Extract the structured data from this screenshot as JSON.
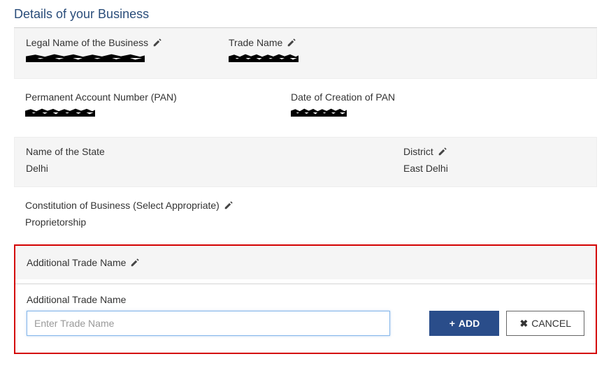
{
  "section_title": "Details of your Business",
  "fields": {
    "legal_name": {
      "label": "Legal Name of the Business",
      "value": "[REDACTED]"
    },
    "trade_name": {
      "label": "Trade Name",
      "value": "[REDACTED]"
    },
    "pan": {
      "label": "Permanent Account Number (PAN)",
      "value": "[REDACTED]"
    },
    "pan_date": {
      "label": "Date of Creation of PAN",
      "value": "[REDACTED]"
    },
    "state": {
      "label": "Name of the State",
      "value": "Delhi"
    },
    "district": {
      "label": "District",
      "value": "East Delhi"
    },
    "constitution": {
      "label": "Constitution of Business (Select Appropriate)",
      "value": "Proprietorship"
    }
  },
  "additional_trade": {
    "header": "Additional Trade Name",
    "input_label": "Additional Trade Name",
    "placeholder": "Enter Trade Name",
    "value": "",
    "add_button": "ADD",
    "cancel_button": "CANCEL"
  }
}
